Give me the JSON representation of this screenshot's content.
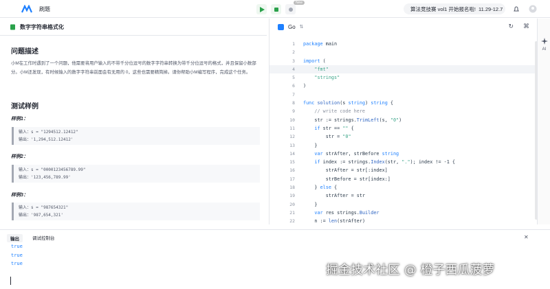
{
  "topbar": {
    "menu_title": "刷题",
    "new_badge": "New",
    "promo_text": "算法竞技赛 vol1 开始报名啦!",
    "promo_date": "11.29-12.7"
  },
  "problem": {
    "tab_title": "数字字符串格式化",
    "section_desc": "问题描述",
    "description": "小M在工作时遇到了一个问题，他需要将用户输入的不带千分位逗号的数字字符串转换为带千分位逗号的格式，并且保留小数部分。小M还发现，有时候输入的数字字符串前面会有无用的 0，这些也需要精简掉。请你帮助小M编写程序，完成这个任务。",
    "section_samples": "测试样例",
    "samples": [
      {
        "title": "样例1：",
        "input_label": "输入：",
        "input": "s = \"1294512.12412\"",
        "output_label": "输出：",
        "output": "'1,294,512.12412'"
      },
      {
        "title": "样例2：",
        "input_label": "输入：",
        "input": "s = \"0000123456789.99\"",
        "output_label": "输出：",
        "output": "'123,456,789.99'"
      },
      {
        "title": "样例3：",
        "input_label": "输入：",
        "input": "s = \"987654321\"",
        "output_label": "输出：",
        "output": "'987,654,321'"
      }
    ]
  },
  "editor": {
    "language": "Go",
    "lines": [
      {
        "n": "1",
        "t": "package main"
      },
      {
        "n": "2",
        "t": ""
      },
      {
        "n": "3",
        "t": "import ("
      },
      {
        "n": "4",
        "t": "    \"fmt\""
      },
      {
        "n": "5",
        "t": "    \"strings\""
      },
      {
        "n": "6",
        "t": ")"
      },
      {
        "n": "7",
        "t": ""
      },
      {
        "n": "8",
        "t": "func solution(s string) string {"
      },
      {
        "n": "9",
        "t": "    // write code here"
      },
      {
        "n": "10",
        "t": "    str := strings.TrimLeft(s, \"0\")"
      },
      {
        "n": "11",
        "t": "    if str == \"\" {"
      },
      {
        "n": "12",
        "t": "        str = \"0\""
      },
      {
        "n": "13",
        "t": "    }"
      },
      {
        "n": "14",
        "t": "    var strAfter, strBefore string"
      },
      {
        "n": "15",
        "t": "    if index := strings.Index(str, \".\"); index != -1 {"
      },
      {
        "n": "16",
        "t": "        strAfter = str[:index]"
      },
      {
        "n": "17",
        "t": "        strBefore = str[index:]"
      },
      {
        "n": "18",
        "t": "    } else {"
      },
      {
        "n": "19",
        "t": "        strAfter = str"
      },
      {
        "n": "20",
        "t": "    }"
      },
      {
        "n": "21",
        "t": "    var res strings.Builder"
      },
      {
        "n": "22",
        "t": "    n := len(strAfter)"
      }
    ]
  },
  "side": {
    "ai_label": "AI"
  },
  "console": {
    "tab_output": "输出",
    "tab_debug": "调试控制台",
    "lines": [
      "true",
      "true",
      "true"
    ]
  },
  "watermark": "掘金技术社区 @ 橙子西瓜菠萝",
  "colors": {
    "accent": "#1e80ff",
    "run_green": "#2aa14b"
  }
}
